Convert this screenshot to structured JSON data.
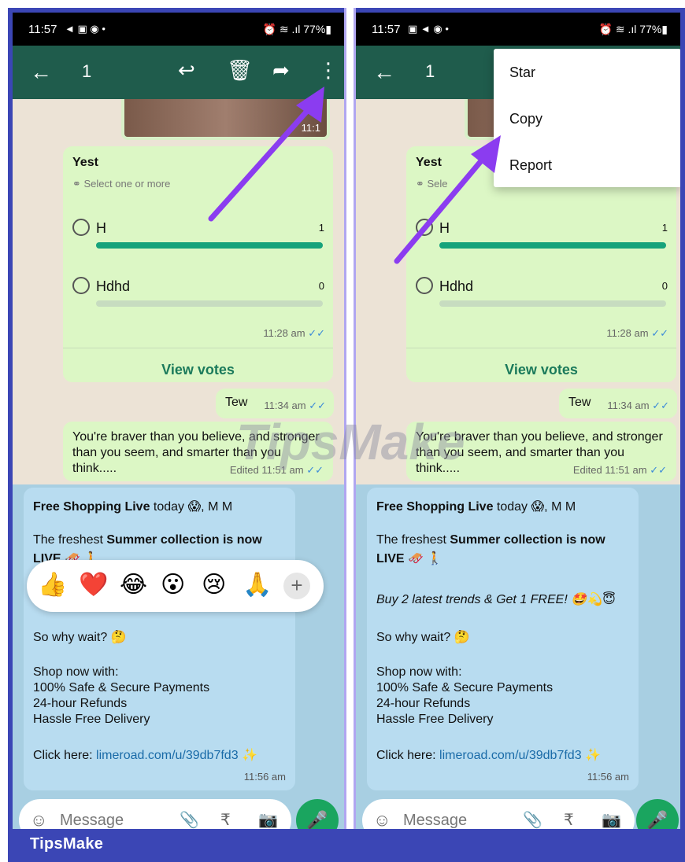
{
  "footer": {
    "brand": "TipsMake"
  },
  "watermark": "TipsMake",
  "left_phone": {
    "status": {
      "time": "11:57",
      "icons": "◄ ▣ ◉ •",
      "right": "⏰ ≋ .ıl 77%▮"
    },
    "appbar": {
      "selected_count": "1",
      "back_icon": "arrow-left-icon",
      "actions": [
        "reply-icon",
        "delete-icon",
        "forward-icon",
        "more-vert-icon"
      ]
    },
    "photo_time": "11:1",
    "poll": {
      "question": "Yest",
      "hint": "Select one or more",
      "options": [
        {
          "label": "H",
          "votes": "1",
          "fill": 1.0
        },
        {
          "label": "Hdhd",
          "votes": "0",
          "fill": 0.0
        }
      ],
      "time": "11:28 am",
      "view_votes": "View votes"
    },
    "tew": {
      "text": "Tew",
      "time": "11:34 am"
    },
    "brave": {
      "text": "You're braver than you believe, and stronger than you seem, and smarter than you think.....",
      "time": "Edited 11:51 am"
    },
    "promo": {
      "l1a": "Free Shopping Live",
      "l1b": " today 😱, M M",
      "l2a": "The freshest ",
      "l2b": "Summer collection is now",
      "l3": "LIVE 🛷 🚶",
      "l4": "So why wait? 🤔",
      "l5": "Shop now with:",
      "l6": "100% Safe & Secure Payments",
      "l7": "24-hour Refunds",
      "l8": "Hassle Free Delivery",
      "l9a": "Click here: ",
      "l9b": "limeroad.com/u/39db7fd3",
      "l9c": " ✨",
      "time": "11:56 am"
    },
    "reactions": [
      "👍",
      "❤️",
      "😂",
      "😮",
      "😢",
      "🙏"
    ],
    "input_placeholder": "Message"
  },
  "right_phone": {
    "status": {
      "time": "11:57",
      "icons": "▣ ◄ ◉ •",
      "right": "⏰ ≋ .ıl 77%▮"
    },
    "appbar": {
      "selected_count": "1",
      "back_icon": "arrow-left-icon"
    },
    "menu": [
      "Star",
      "Copy",
      "Report"
    ],
    "poll": {
      "question": "Yest",
      "hint": "Sele",
      "options": [
        {
          "label": "H",
          "votes": "1",
          "fill": 1.0
        },
        {
          "label": "Hdhd",
          "votes": "0",
          "fill": 0.0
        }
      ],
      "time": "11:28 am",
      "view_votes": "View votes"
    },
    "tew": {
      "text": "Tew",
      "time": "11:34 am"
    },
    "brave": {
      "text": "You're braver than you believe, and stronger than you seem, and smarter than you think.....",
      "time": "Edited 11:51 am"
    },
    "promo": {
      "l1a": "Free Shopping Live",
      "l1b": " today 😱, M M",
      "l2a": "The freshest ",
      "l2b": "Summer collection is now",
      "l3": "LIVE 🛷 🚶",
      "l3b": "Buy 2 latest trends & Get 1 FREE! 🤩💫😇",
      "l4": "So why wait? 🤔",
      "l5": "Shop now with:",
      "l6": "100% Safe & Secure Payments",
      "l7": "24-hour Refunds",
      "l8": "Hassle Free Delivery",
      "l9a": "Click here: ",
      "l9b": "limeroad.com/u/39db7fd3",
      "l9c": " ✨",
      "time": "11:56 am"
    },
    "input_placeholder": "Message"
  },
  "colors": {
    "appbar": "#1f5c4c",
    "bubble": "#dcf7c5",
    "accent": "#16a37b",
    "arrow": "#8b3cf0",
    "frame": "#3b46b5"
  }
}
